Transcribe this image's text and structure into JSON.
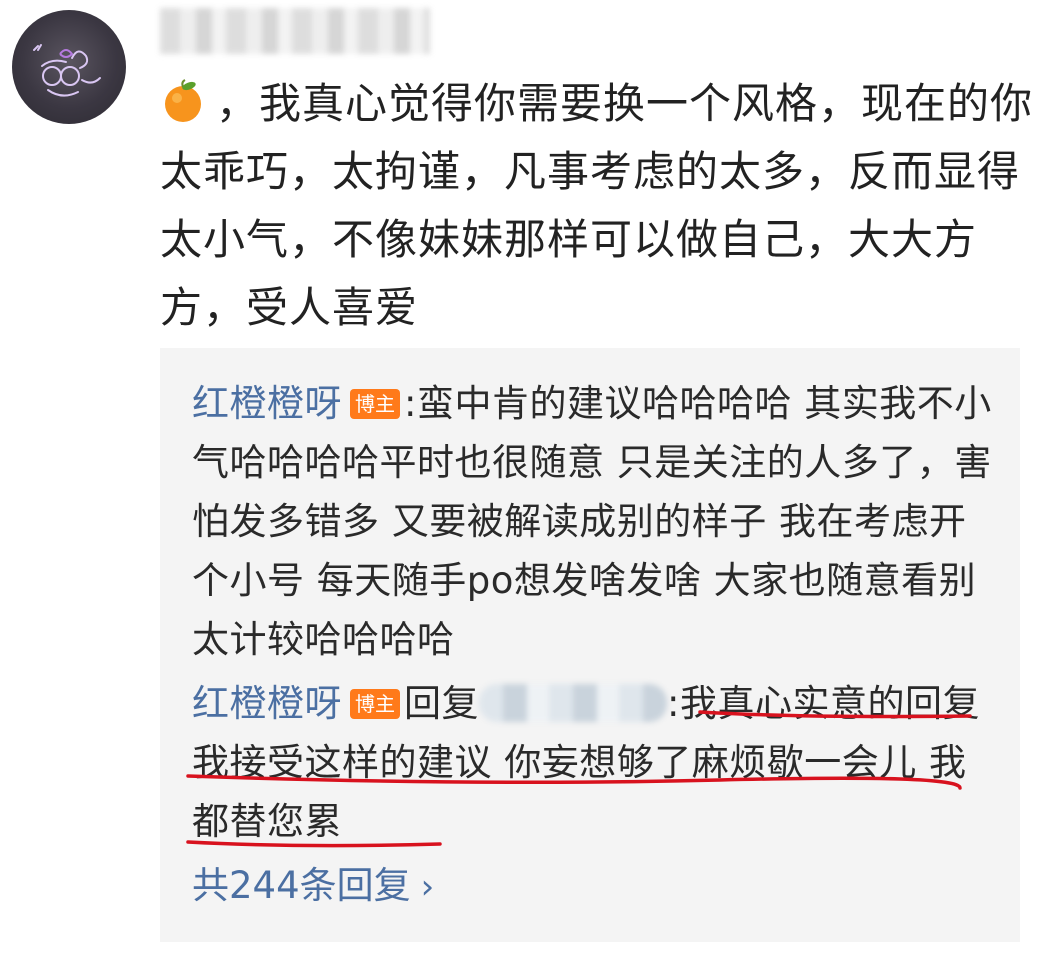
{
  "comment": {
    "emoji": "orange-emoji",
    "text": "，我真心觉得你需要换一个风格，现在的你太乖巧，太拘谨，凡事考虑的太多，反而显得太小气，不像妹妹那样可以做自己，大大方方，受人喜爱"
  },
  "replies": [
    {
      "username": "红橙橙呀",
      "badge": "博主",
      "separator": ":",
      "text": "蛮中肯的建议哈哈哈哈 其实我不小气哈哈哈哈平时也很随意 只是关注的人多了，害怕发多错多 又要被解读成别的样子 我在考虑开个小号 每天随手po想发啥发啥 大家也随意看别太计较哈哈哈哈"
    },
    {
      "username": "红橙橙呀",
      "badge": "博主",
      "reply_word": "回复",
      "separator": ":",
      "text": "我真心实意的回复 我接受这样的建议 你妄想够了麻烦歇一会儿 我都替您累"
    }
  ],
  "more_replies": "共244条回复",
  "colors": {
    "link": "#4b6fa2",
    "badge": "#ff7a1a",
    "annotation": "#d8121e",
    "reply_bg": "#f4f4f4"
  }
}
